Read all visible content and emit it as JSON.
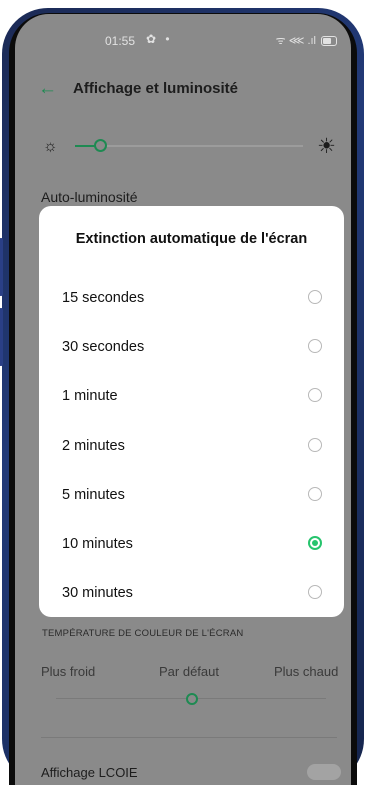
{
  "status_bar": {
    "time": "01:55",
    "left_icons": "✿ •",
    "signal_text": "ᯤ ⋘ .ıl"
  },
  "header": {
    "title": "Affichage et luminosité"
  },
  "background": {
    "brightness_level": 0.1,
    "auto_brightness_label": "Auto-luminosité",
    "color_temp_section": "TEMPÉRATURE DE COULEUR DE L'ÉCRAN",
    "temp_cold": "Plus froid",
    "temp_default": "Par défaut",
    "temp_warm": "Plus chaud",
    "next_item": "Affichage LCOIE"
  },
  "dialog": {
    "title": "Extinction automatique de l'écran",
    "options": [
      {
        "label": "15 secondes",
        "selected": false
      },
      {
        "label": "30 secondes",
        "selected": false
      },
      {
        "label": "1 minute",
        "selected": false
      },
      {
        "label": "2 minutes",
        "selected": false
      },
      {
        "label": "5 minutes",
        "selected": false
      },
      {
        "label": "10 minutes",
        "selected": true
      },
      {
        "label": "30 minutes",
        "selected": false
      }
    ]
  },
  "colors": {
    "accent": "#26c46d",
    "accent_dark": "#1e8a52",
    "scrim_bg": "#8a8a8a"
  }
}
